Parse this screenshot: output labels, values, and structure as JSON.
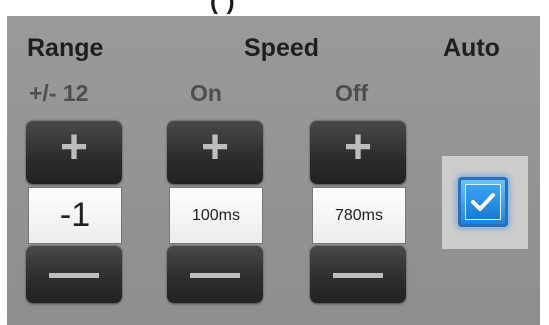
{
  "window": {
    "title_partial": "(      )"
  },
  "headers": {
    "range": "Range",
    "speed": "Speed",
    "auto": "Auto"
  },
  "subheaders": {
    "range": "+/- 12",
    "on": "On",
    "off": "Off"
  },
  "steppers": {
    "range": {
      "plus": "+",
      "minus": "—",
      "value": "-1"
    },
    "on": {
      "plus": "+",
      "minus": "—",
      "value": "100ms"
    },
    "off": {
      "plus": "+",
      "minus": "—",
      "value": "780ms"
    }
  },
  "auto": {
    "checked": true,
    "check_color": "#ffffff",
    "accent": "#2a8be6"
  },
  "colors": {
    "panel": "#959595",
    "button": "#2e2e2e",
    "value_bg": "#f4f4f4"
  }
}
